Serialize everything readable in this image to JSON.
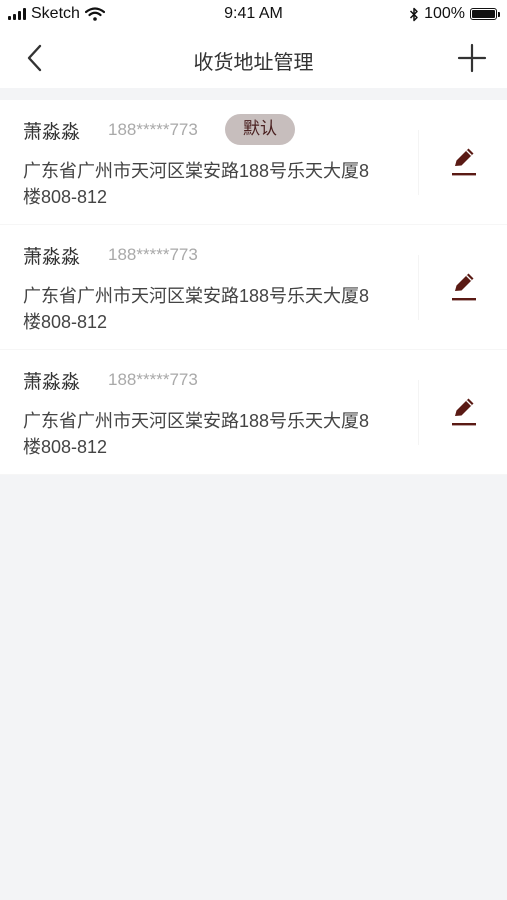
{
  "status_bar": {
    "carrier": "Sketch",
    "time": "9:41 AM",
    "battery": "100%"
  },
  "navbar": {
    "title": "收货地址管理"
  },
  "colors": {
    "accent": "#5a1a14",
    "badge_bg": "#c7bebd",
    "phone": "#a9a9a9"
  },
  "addresses": [
    {
      "name": "萧淼淼",
      "phone": "188*****773",
      "badge": "默认",
      "line1": "广东省广州市天河区棠安路188号乐天大厦8",
      "line2": "楼808-812"
    },
    {
      "name": "萧淼淼",
      "phone": "188*****773",
      "line1": "广东省广州市天河区棠安路188号乐天大厦8",
      "line2": "楼808-812"
    },
    {
      "name": "萧淼淼",
      "phone": "188*****773",
      "line1": "广东省广州市天河区棠安路188号乐天大厦8",
      "line2": "楼808-812"
    }
  ]
}
